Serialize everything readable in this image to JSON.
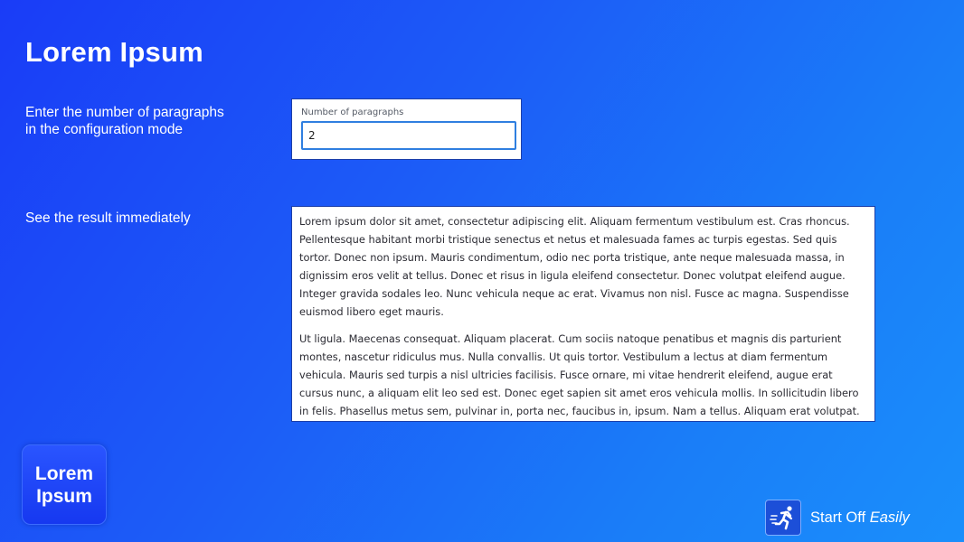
{
  "page": {
    "title": "Lorem Ipsum"
  },
  "steps": [
    {
      "line1": "Enter the number of paragraphs",
      "line2": "in the configuration mode"
    },
    {
      "line1": "See the result immediately"
    }
  ],
  "config": {
    "field_label": "Number of paragraphs",
    "field_value": "2"
  },
  "result": {
    "paragraphs": [
      "Lorem ipsum dolor sit amet, consectetur adipiscing elit. Aliquam fermentum vestibulum est. Cras rhoncus. Pellentesque habitant morbi tristique senectus et netus et malesuada fames ac turpis egestas. Sed quis tortor. Donec non ipsum. Mauris condimentum, odio nec porta tristique, ante neque malesuada massa, in dignissim eros velit at tellus. Donec et risus in ligula eleifend consectetur. Donec volutpat eleifend augue. Integer gravida sodales leo. Nunc vehicula neque ac erat. Vivamus non nisl. Fusce ac magna. Suspendisse euismod libero eget mauris.",
      "Ut ligula. Maecenas consequat. Aliquam placerat. Cum sociis natoque penatibus et magnis dis parturient montes, nascetur ridiculus mus. Nulla convallis. Ut quis tortor. Vestibulum a lectus at diam fermentum vehicula. Mauris sed turpis a nisl ultricies facilisis. Fusce ornare, mi vitae hendrerit eleifend, augue erat cursus nunc, a aliquam elit leo sed est. Donec eget sapien sit amet eros vehicula mollis. In sollicitudin libero in felis. Phasellus metus sem, pulvinar in, porta nec, faucibus in, ipsum. Nam a tellus. Aliquam erat volutpat."
    ]
  },
  "logo": {
    "line1": "Lorem",
    "line2": "Ipsum"
  },
  "brand": {
    "icon": "running-man-icon",
    "text_plain": "Start Off",
    "text_italic": "Easily"
  },
  "colors": {
    "background_start": "#1a3cf7",
    "background_end": "#1a8ffb",
    "input_border": "#2f7fe0",
    "panel_border": "#1d3fa8"
  }
}
